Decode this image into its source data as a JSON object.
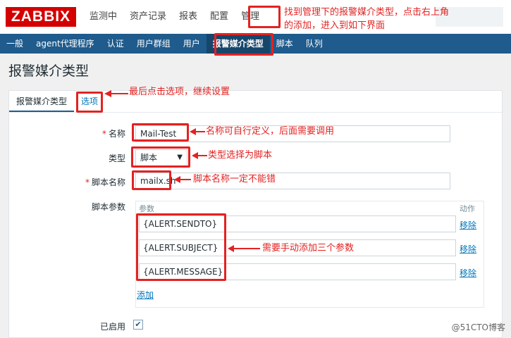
{
  "logo": "ZABBIX",
  "main_menu": [
    "监测中",
    "资产记录",
    "报表",
    "配置",
    "管理"
  ],
  "sub_menu": [
    "一般",
    "agent代理程序",
    "认证",
    "用户群组",
    "用户",
    "报警媒介类型",
    "脚本",
    "队列"
  ],
  "page_title": "报警媒介类型",
  "tabs": [
    "报警媒介类型",
    "选项"
  ],
  "form": {
    "name_label": "名称",
    "name_value": "Mail-Test",
    "type_label": "类型",
    "type_value": "脚本",
    "script_name_label": "脚本名称",
    "script_name_value": "mailx.sh",
    "params_label": "脚本参数",
    "params_col_param": "参数",
    "params_col_action": "动作",
    "params": [
      "{ALERT.SENDTO}",
      "{ALERT.SUBJECT}",
      "{ALERT.MESSAGE}"
    ],
    "remove_label": "移除",
    "add_label": "添加",
    "enabled_label": "已启用",
    "enabled": true
  },
  "annotations": {
    "manage": "找到管理下的报警媒介类型，点击右上角",
    "manage2": "的添加，进入到如下界面",
    "options": "最后点击选项，继续设置",
    "name": "名称可自行定义，后面需要调用",
    "type": "类型选择为脚本",
    "script": "脚本名称一定不能错",
    "params": "需要手动添加三个参数"
  },
  "watermark": "@51CTO博客",
  "colors": {
    "annotation": "#e32222",
    "submenu_bg": "#1f5b8c",
    "logo_bg": "#d40000"
  }
}
